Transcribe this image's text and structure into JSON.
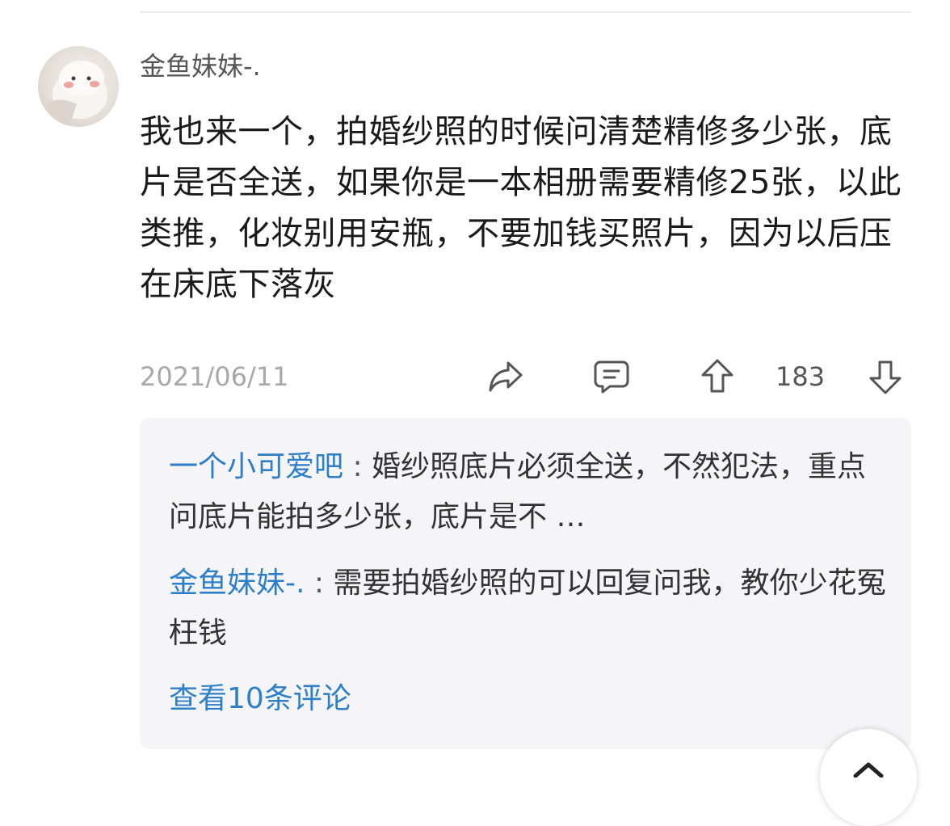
{
  "comment": {
    "username": "金鱼妹妹-.",
    "text": "我也来一个，拍婚纱照的时候问清楚精修多少张，底片是否全送，如果你是一本相册需要精修25张，以此类推，化妆别用安瓶，不要加钱买照片，因为以后压在床底下落灰",
    "date": "2021/06/11",
    "upvotes": "183"
  },
  "replies": [
    {
      "author": "一个小可爱吧",
      "separator": " : ",
      "text": "婚纱照底片必须全送，不然犯法，重点问底片能拍多少张，底片是不 …"
    },
    {
      "author": "金鱼妹妹-.",
      "separator": " : ",
      "text": "需要拍婚纱照的可以回复问我，教你少花冤枉钱"
    }
  ],
  "view_more": "查看10条评论",
  "icons": {
    "share": "share-icon",
    "comment": "comment-icon",
    "upvote": "upvote-icon",
    "downvote": "downvote-icon",
    "scroll_top": "chevron-up-icon"
  },
  "colors": {
    "link": "#2e7fc9",
    "muted": "#a8a8a8",
    "reply_bg": "#f5f5f7"
  }
}
